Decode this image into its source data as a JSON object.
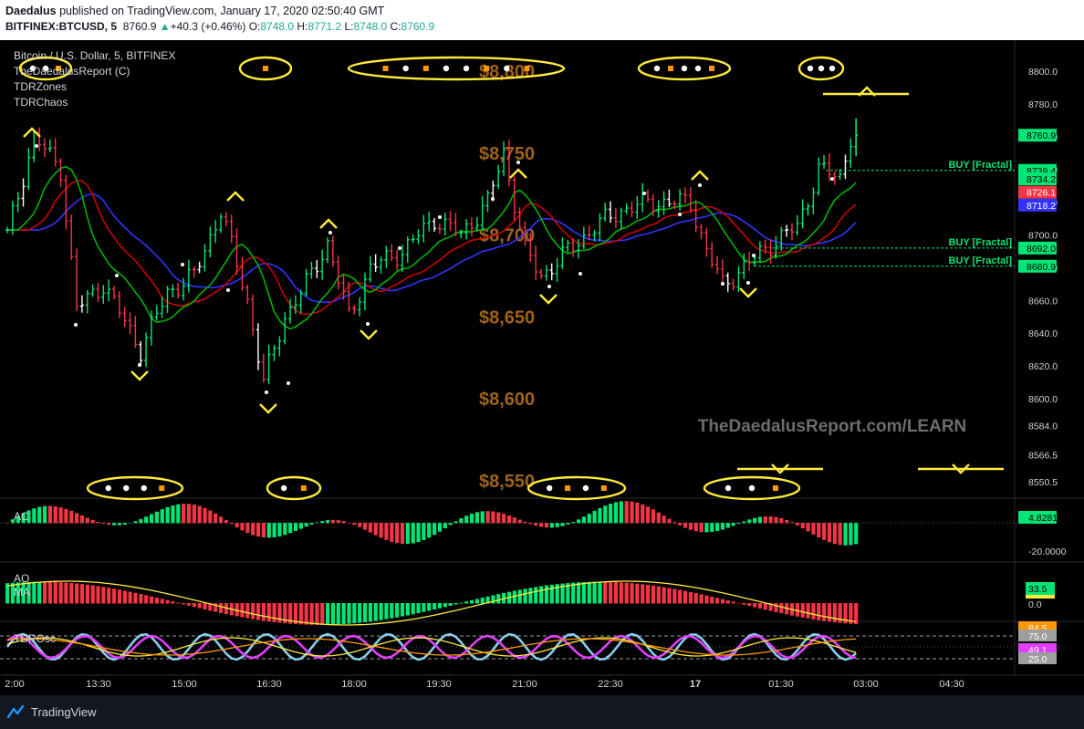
{
  "header": {
    "publisher": "Daedalus",
    "published_text": "published on TradingView.com, January 17, 2020 02:50:40 GMT",
    "symbol": "BITFINEX:BTCUSD, 5",
    "last": "8760.9",
    "change": "+40.3 (+0.46%)",
    "o_label": "O:",
    "o": "8748.0",
    "h_label": "H:",
    "h": "8771.2",
    "l_label": "L:",
    "l": "8748.0",
    "c_label": "C:",
    "c": "8760.9"
  },
  "legend": {
    "title": "Bitcoin / U.S. Dollar, 5, BITFINEX",
    "indicator1": "TheDaedalusReport (C)",
    "indicator2": "TDRZones",
    "indicator3": "TDRChaos"
  },
  "watermark": "TheDaedalusReport.com/LEARN",
  "level_labels": [
    {
      "text": "$8,800",
      "price": 8800
    },
    {
      "text": "$8,750",
      "price": 8750
    },
    {
      "text": "$8,700",
      "price": 8700
    },
    {
      "text": "$8,650",
      "price": 8650
    },
    {
      "text": "$8,600",
      "price": 8600
    },
    {
      "text": "$8,550",
      "price": 8550
    }
  ],
  "fractal_labels": [
    {
      "text": "BUY [Fractal]",
      "price": 8739.4
    },
    {
      "text": "BUY [Fractal]",
      "price": 8692.0
    },
    {
      "text": "BUY [Fractal]",
      "price": 8680.9
    }
  ],
  "price_axis_ticks": [
    "8800.0",
    "8780.0",
    "8760.0",
    "8740.0",
    "8720.0",
    "8700.0",
    "8680.0",
    "8660.0",
    "8640.0",
    "8620.0",
    "8600.0",
    "8584.0",
    "8566.5",
    "8550.5"
  ],
  "price_axis_tick_values": [
    8800,
    8780,
    8760,
    8740,
    8720,
    8700,
    8680,
    8660,
    8640,
    8620,
    8600,
    8584,
    8566.5,
    8550.5
  ],
  "price_badges": [
    {
      "text": "8760.9",
      "value": 8760.9,
      "color": "#00e676"
    },
    {
      "text": "8739.4",
      "value": 8739.4,
      "color": "#00e676"
    },
    {
      "text": "8734.2",
      "value": 8734.2,
      "color": "#00e676"
    },
    {
      "text": "8726.1",
      "value": 8726.1,
      "color": "#f23645"
    },
    {
      "text": "8718.2",
      "value": 8718.2,
      "color": "#3333ff"
    },
    {
      "text": "8692.0",
      "value": 8692.0,
      "color": "#00e676"
    },
    {
      "text": "8680.9",
      "value": 8680.9,
      "color": "#00e676"
    }
  ],
  "time_axis_ticks": [
    "2:00",
    "13:30",
    "15:00",
    "16:30",
    "18:00",
    "19:30",
    "21:00",
    "22:30",
    "17",
    "01:30",
    "03:00",
    "04:30"
  ],
  "panes": {
    "ac": {
      "label": "AC",
      "value_badge": "4.8281",
      "badge_color": "#00e676",
      "axis_tick": "-20.0000"
    },
    "ao": {
      "label1": "AO",
      "label2": "MA",
      "value_badge": "33.5",
      "badge_color": "#00e676",
      "axis_tick": "0.0"
    },
    "tdrosc": {
      "label": "TDROsc",
      "badges": [
        {
          "text": "84.5",
          "color": "#ff9800"
        },
        {
          "text": "75.0",
          "color": "#9e9e9e"
        },
        {
          "text": "49.1",
          "color": "#e040fb"
        },
        {
          "text": "25.0",
          "color": "#9e9e9e"
        }
      ]
    }
  },
  "colors": {
    "background": "#000000",
    "up": "#00e676",
    "down": "#f23645",
    "neutral": "#ffffff",
    "jaw": "#3333ff",
    "teeth": "#cc0000",
    "lips": "#00b300",
    "marker": "#ffeb3b",
    "level_text": "#a0621a",
    "fractal": "#00e676"
  },
  "footer": {
    "brand": "TradingView"
  },
  "chart_data": {
    "type": "candlestick",
    "title": "Bitcoin / U.S. Dollar, 5, BITFINEX",
    "interval": "5",
    "ylim": [
      8540,
      8820
    ],
    "grid": false,
    "price_points": [
      {
        "t": 0,
        "p": 8700
      },
      {
        "t": 5,
        "p": 8760
      },
      {
        "t": 10,
        "p": 8740
      },
      {
        "t": 13,
        "p": 8655
      },
      {
        "t": 18,
        "p": 8670
      },
      {
        "t": 25,
        "p": 8630
      },
      {
        "t": 30,
        "p": 8665
      },
      {
        "t": 35,
        "p": 8675
      },
      {
        "t": 40,
        "p": 8715
      },
      {
        "t": 45,
        "p": 8660
      },
      {
        "t": 48,
        "p": 8610
      },
      {
        "t": 52,
        "p": 8650
      },
      {
        "t": 56,
        "p": 8670
      },
      {
        "t": 60,
        "p": 8695
      },
      {
        "t": 64,
        "p": 8650
      },
      {
        "t": 68,
        "p": 8680
      },
      {
        "t": 74,
        "p": 8690
      },
      {
        "t": 80,
        "p": 8710
      },
      {
        "t": 85,
        "p": 8700
      },
      {
        "t": 90,
        "p": 8720
      },
      {
        "t": 93,
        "p": 8750
      },
      {
        "t": 97,
        "p": 8690
      },
      {
        "t": 100,
        "p": 8675
      },
      {
        "t": 105,
        "p": 8690
      },
      {
        "t": 110,
        "p": 8705
      },
      {
        "t": 115,
        "p": 8715
      },
      {
        "t": 120,
        "p": 8720
      },
      {
        "t": 124,
        "p": 8720
      },
      {
        "t": 128,
        "p": 8720
      },
      {
        "t": 131,
        "p": 8690
      },
      {
        "t": 134,
        "p": 8670
      },
      {
        "t": 138,
        "p": 8680
      },
      {
        "t": 142,
        "p": 8692
      },
      {
        "t": 148,
        "p": 8705
      },
      {
        "t": 152,
        "p": 8740
      },
      {
        "t": 156,
        "p": 8735
      },
      {
        "t": 158,
        "p": 8760
      }
    ],
    "current": {
      "open": 8748.0,
      "high": 8771.2,
      "low": 8748.0,
      "close": 8760.9,
      "change": 40.3,
      "change_pct": 0.46
    },
    "fractal_buy_levels": [
      8739.4,
      8692.0,
      8680.9
    ],
    "alligator": {
      "jaw": 8718.2,
      "teeth": 8726.1,
      "lips": 8734.2
    }
  }
}
